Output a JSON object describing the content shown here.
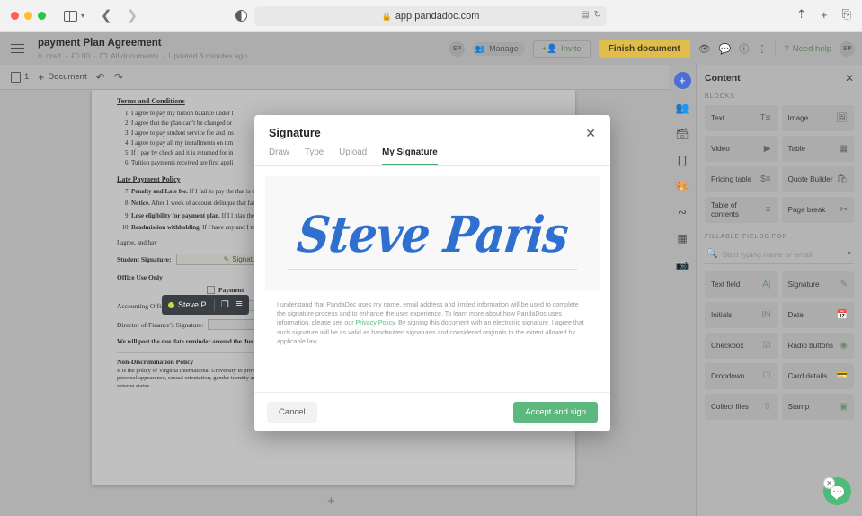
{
  "browser": {
    "url": "app.pandadoc.com",
    "lock_icon": "lock-icon",
    "back_icon": "chevron-left-icon",
    "forward_icon": "chevron-right-icon",
    "sidebar_icon": "sidebar-toggle-icon",
    "chevron_icon": "chevron-down-icon",
    "contrast_icon": "reader-contrast-icon",
    "translate_icon": "translate-icon",
    "reload_icon": "reload-icon",
    "share_icon": "share-icon",
    "newtab_icon": "plus-icon",
    "tabs_icon": "tab-overview-icon"
  },
  "app_header": {
    "menu_icon": "hamburger-menu-icon",
    "title": "payment Plan Agreement",
    "status": "draft",
    "amount": "£0.00",
    "folder": "All documents",
    "updated": "Updated 6 minutes ago",
    "avatar_initials": "SP",
    "manage_label": "Manage",
    "invite_label": "Invite",
    "finish_label": "Finish document",
    "need_help_label": "Need help",
    "user_initials": "SP",
    "preview_icon": "eye-icon",
    "comments_icon": "comment-icon",
    "info_icon": "info-icon",
    "more_icon": "kebab-menu-icon",
    "help_icon": "question-mark-icon",
    "manage_icon": "people-icon",
    "invite_icon": "add-person-icon"
  },
  "toolbar": {
    "pages_count": "1",
    "document_label": "Document",
    "add_icon": "plus-icon",
    "undo_icon": "undo-icon",
    "redo_icon": "redo-icon",
    "pages_icon": "pages-icon"
  },
  "document": {
    "terms_heading": "Terms and Conditions",
    "terms": [
      "I agree to pay my tuition balance under t",
      "I agree that the plan can’t be changed or",
      "I agree to pay student service fee and ins",
      "I agree to pay all my installments on tim",
      "If I pay by check and it is returned for in",
      "Tuition payments received are first appli"
    ],
    "late_heading": "Late Payment Policy",
    "late_items": [
      {
        "n": "7.",
        "bold": "Penalty and Late fee.",
        "text": " If I fail to pay the that is delinquent. I understand that this added to my account starting from the d holidays are counted towards the late da"
      },
      {
        "n": "8.",
        "bold": "Notice.",
        "text": " After 1 week of account delinque that failure to pay my dues could affect"
      },
      {
        "n": "9.",
        "bold": "Lose eligibility for payment plan.",
        "text": " If I l plan the following semester."
      },
      {
        "n": "10.",
        "bold": "Readmission withholding.",
        "text": " If I have any and I may risk my student status."
      }
    ],
    "agree_line": "I agree, and hav",
    "student_signature_label": "Student Signature:",
    "signature_field_label": "Signature",
    "signature_field_icon": "pen-icon",
    "office_heading": "Office Use Only",
    "payment_checkbox_label": "Payment",
    "accounting_label": "Accounting Officer’s Signature:",
    "finance_label": "Director of Finance’s Signature:",
    "reminder_text": "We will post the due date reminder around the due dates and avoid any additional fees.",
    "nd_heading": "Non-Discrimination Policy",
    "nd_body": "It is the policy of Virginia International University to provide equal educational opportunities for all people regardless of race, color, religion, national origin, sex, age, marital status, personal appearance, sexual orientation, gender identity and expression, family responsibilities, political affiliation, disability, source of income, place of residence or business, and veteran status.",
    "add_page_icon": "plus-icon",
    "recipient_toolbar": {
      "name": "Steve P.",
      "duplicate_icon": "duplicate-icon",
      "align_icon": "align-icon"
    }
  },
  "rail": {
    "items": [
      {
        "icon": "add-content-icon"
      },
      {
        "icon": "recipients-icon"
      },
      {
        "icon": "cards-icon"
      },
      {
        "icon": "variables-icon"
      },
      {
        "icon": "theme-palette-icon"
      },
      {
        "icon": "workflow-icon"
      },
      {
        "icon": "apps-grid-icon"
      },
      {
        "icon": "media-library-icon"
      }
    ]
  },
  "panel": {
    "title": "Content",
    "close_icon": "close-icon",
    "blocks_label": "BLOCKS",
    "blocks": [
      {
        "label": "Text",
        "icon": "text-icon"
      },
      {
        "label": "Image",
        "icon": "image-icon"
      },
      {
        "label": "Video",
        "icon": "video-icon"
      },
      {
        "label": "Table",
        "icon": "table-icon"
      },
      {
        "label": "Pricing table",
        "icon": "pricing-table-icon"
      },
      {
        "label": "Quote Builder",
        "icon": "quote-builder-icon"
      },
      {
        "label": "Table of contents",
        "icon": "toc-icon"
      },
      {
        "label": "Page break",
        "icon": "scissors-icon"
      }
    ],
    "fillable_label": "FILLABLE FIELDS FOR",
    "search_placeholder": "Start typing name or email",
    "search_icon": "search-icon",
    "dropdown_icon": "chevron-down-icon",
    "fields": [
      {
        "label": "Text field",
        "icon": "text-field-icon"
      },
      {
        "label": "Signature",
        "icon": "signature-pen-icon"
      },
      {
        "label": "Initials",
        "icon": "initials-icon"
      },
      {
        "label": "Date",
        "icon": "calendar-icon"
      },
      {
        "label": "Checkbox",
        "icon": "checkbox-icon"
      },
      {
        "label": "Radio buttons",
        "icon": "radio-button-icon"
      },
      {
        "label": "Dropdown",
        "icon": "dropdown-icon"
      },
      {
        "label": "Card details",
        "icon": "credit-card-icon"
      },
      {
        "label": "Collect files",
        "icon": "upload-icon"
      },
      {
        "label": "Stamp",
        "icon": "stamp-icon"
      }
    ]
  },
  "modal": {
    "title": "Signature",
    "close_icon": "close-icon",
    "tabs": [
      {
        "label": "Draw",
        "active": false
      },
      {
        "label": "Type",
        "active": false
      },
      {
        "label": "Upload",
        "active": false
      },
      {
        "label": "My Signature",
        "active": true
      }
    ],
    "signature_text": "Steve Paris",
    "signature_color": "#2f6fd0",
    "disclaimer_part1": "I understand that PandaDoc uses my name, email address and limited information will be used to complete the signature process and to enhance the user experience. To learn more about how PandaDoc uses information, please see our ",
    "privacy_link": "Privacy Policy",
    "disclaimer_part2": ". By signing this document with an electronic signature, I agree that such signature will be as valid as handwritten signatures and considered originals to the extent allowed by applicable law.",
    "cancel_label": "Cancel",
    "accept_label": "Accept and sign",
    "accent_color": "#5cb87f"
  },
  "chat": {
    "bubble_icon": "chat-bubble-icon",
    "close_icon": "close-icon",
    "color": "#4fbb7a"
  }
}
